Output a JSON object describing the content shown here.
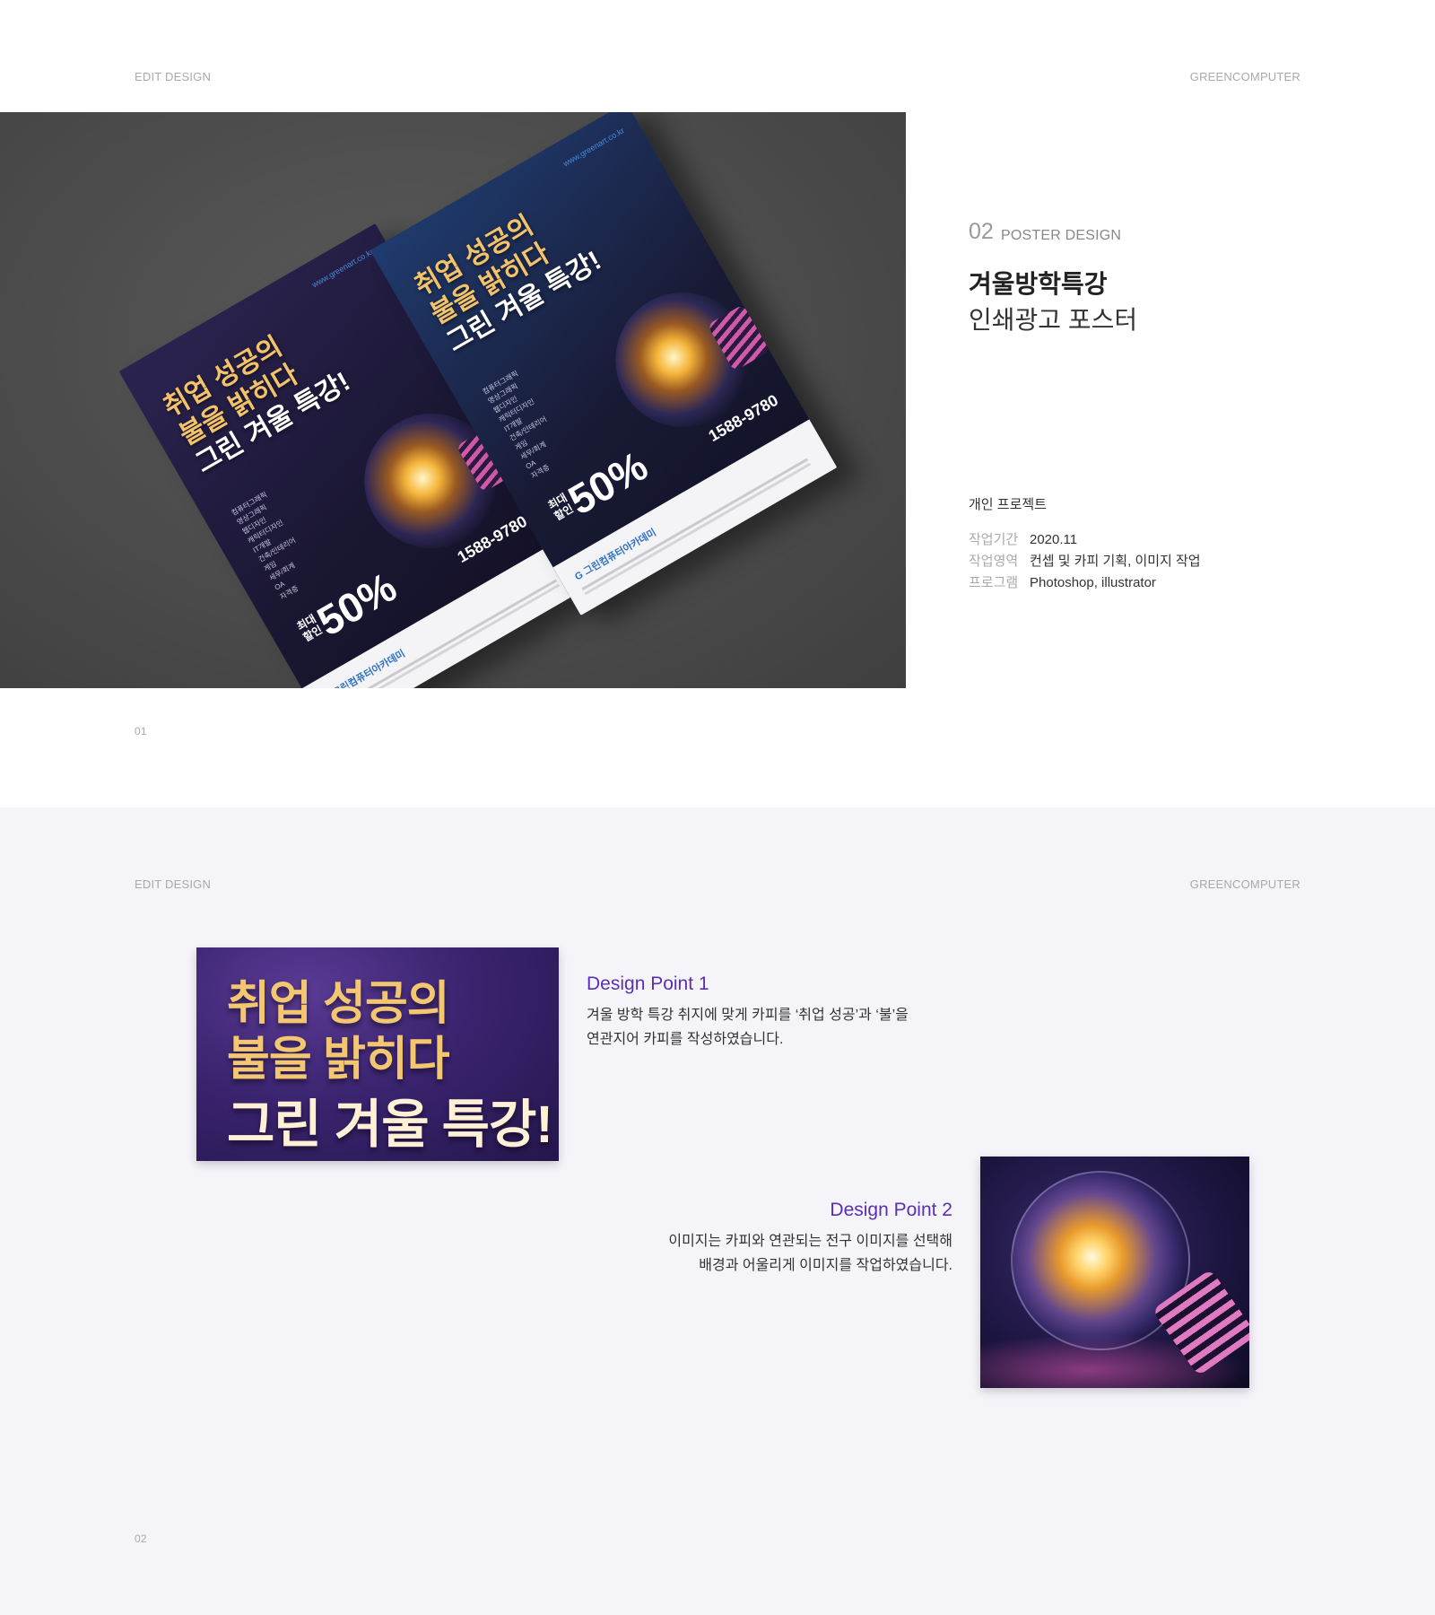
{
  "section1": {
    "header_left": "EDIT DESIGN",
    "header_right": "GREENCOMPUTER",
    "page_number": "01",
    "mockup": {
      "poster_headline": [
        "취업 성공의",
        "불을 밝히다",
        "그린 겨울 특강!"
      ],
      "poster_url": "www.greenart.co.kr",
      "poster_list": [
        "컴퓨터그래픽",
        "영상그래픽",
        "웹디자인",
        "캐릭터디자인",
        "IT개발",
        "건축/인테리어",
        "게임",
        "세무/회계",
        "OA",
        "자격증"
      ],
      "poster_discount_prefix": "최대 할인",
      "poster_discount": "50%",
      "poster_phone": "1588-9780",
      "poster_brand": "G 그린컴퓨터아카데미"
    },
    "project": {
      "number": "02",
      "category": "POSTER DESIGN",
      "title": "겨울방학특강",
      "subtitle": "인쇄광고 포스터",
      "type": "개인 프로젝트",
      "meta": [
        {
          "key": "작업기간",
          "value": "2020.11"
        },
        {
          "key": "작업영역",
          "value": "컨셉 및 카피 기획, 이미지 작업"
        },
        {
          "key": "프로그램",
          "value": "Photoshop, illustrator"
        }
      ]
    }
  },
  "section2": {
    "header_left": "EDIT DESIGN",
    "header_right": "GREENCOMPUTER",
    "page_number": "02",
    "copy_crop": [
      "취업 성공의",
      "불을 밝히다",
      "그린 겨울 특강!"
    ],
    "design_point_1": {
      "title": "Design Point 1",
      "lines": [
        "겨울 방학 특강 취지에 맞게 카피를 ‘취업 성공’과 ‘불’을",
        "연관지어 카피를 작성하였습니다."
      ]
    },
    "design_point_2": {
      "title": "Design Point 2",
      "lines": [
        "이미지는 카피와 연관되는 전구 이미지를 선택해",
        "배경과 어울리게 이미지를 작업하였습니다."
      ]
    }
  },
  "colors": {
    "accent_purple": "#5b2fb2",
    "headline_gold": "#f3c771",
    "section2_bg": "#f4f4f9",
    "mockup_bg": "#4a4a4a"
  }
}
